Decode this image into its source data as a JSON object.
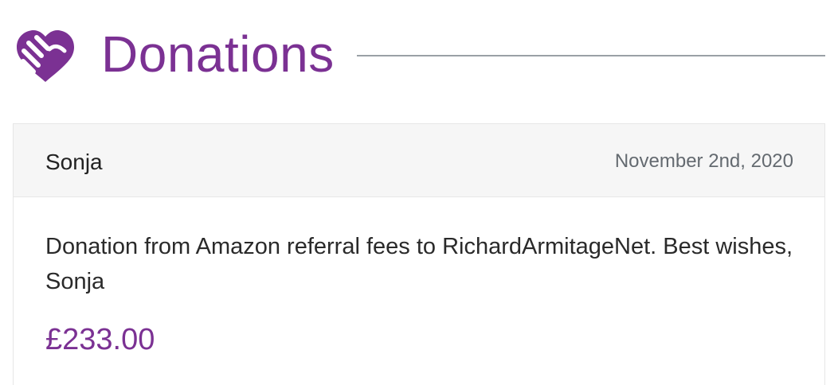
{
  "header": {
    "title": "Donations",
    "icon": "heart-handshake-icon",
    "accent_color": "#7b3193"
  },
  "donation": {
    "donor": "Sonja",
    "date": "November 2nd, 2020",
    "message": "Donation from Amazon referral fees to RichardArmitageNet. Best wishes, Sonja",
    "amount": "£233.00"
  }
}
